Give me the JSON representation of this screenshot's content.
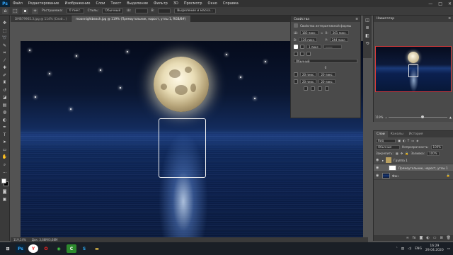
{
  "menubar": {
    "app": "Ps",
    "items": [
      "Файл",
      "Редактирование",
      "Изображение",
      "Слои",
      "Текст",
      "Выделение",
      "Фильтр",
      "3D",
      "Просмотр",
      "Окно",
      "Справка"
    ],
    "controls": [
      "—",
      "□",
      "✕"
    ]
  },
  "optbar": {
    "tool_icon": "marquee-icon",
    "feather_label": "Растушевка:",
    "feather_value": "0 пикс.",
    "style_label": "Стиль:",
    "style_value": "Обычный",
    "width_label": "Ш:",
    "height_label": "В:",
    "mask_button": "Выделение и маска..."
  },
  "tabs": [
    "DMB79965.3.jpg @ 114% (Слой...)",
    "moonnightbeach.jpg @ 119% (Прямоугольник, нарост, углы 1, RGB/8#)"
  ],
  "properties": {
    "title": "Свойства",
    "section": "Свойства интерактивной формы",
    "w_label": "Ш:",
    "w_value": "183 пикс.",
    "x_label": "X:",
    "x_value": "201 пикс.",
    "h_label": "В:",
    "h_value": "126 пикс.",
    "y_label": "Y:",
    "y_value": "244 пикс.",
    "stroke_width": "1 пикс.",
    "corner_a": "20 пикс.",
    "corner_b": "20 пикс.",
    "corner_c": "20 пикс.",
    "corner_d": "20 пикс.",
    "blend_mode": "Обычный",
    "angle_value": "0"
  },
  "navigator": {
    "title": "Навигатор",
    "zoom": "119%"
  },
  "layers": {
    "tabs": [
      "Слои",
      "Каналы",
      "История"
    ],
    "kind_label": "Вид",
    "blend_mode": "Обычные",
    "opacity_label": "Непрозрачность:",
    "opacity_value": "100%",
    "lock_label": "Закрепить:",
    "fill_label": "Заливка:",
    "fill_value": "100%",
    "items": [
      {
        "name": "Группа 1",
        "type": "group"
      },
      {
        "name": "Прямоугольник, нарост, углы 1",
        "type": "shape"
      },
      {
        "name": "Фон",
        "type": "image"
      }
    ]
  },
  "statusbar": {
    "zoom": "119,14%",
    "doc_info": "Док: 3,68M/3,68M"
  },
  "taskbar": {
    "apps": [
      "Windows",
      "Photoshop",
      "Yandex",
      "Opera",
      "Chrome",
      "Camtasia",
      "Skype",
      "Folder"
    ],
    "lang": "ENG",
    "time": "16:29",
    "date": "29.04.2020"
  },
  "colors": {
    "accent_selection": "#d23a3a",
    "photoshop_blue": "#31a8ff"
  }
}
